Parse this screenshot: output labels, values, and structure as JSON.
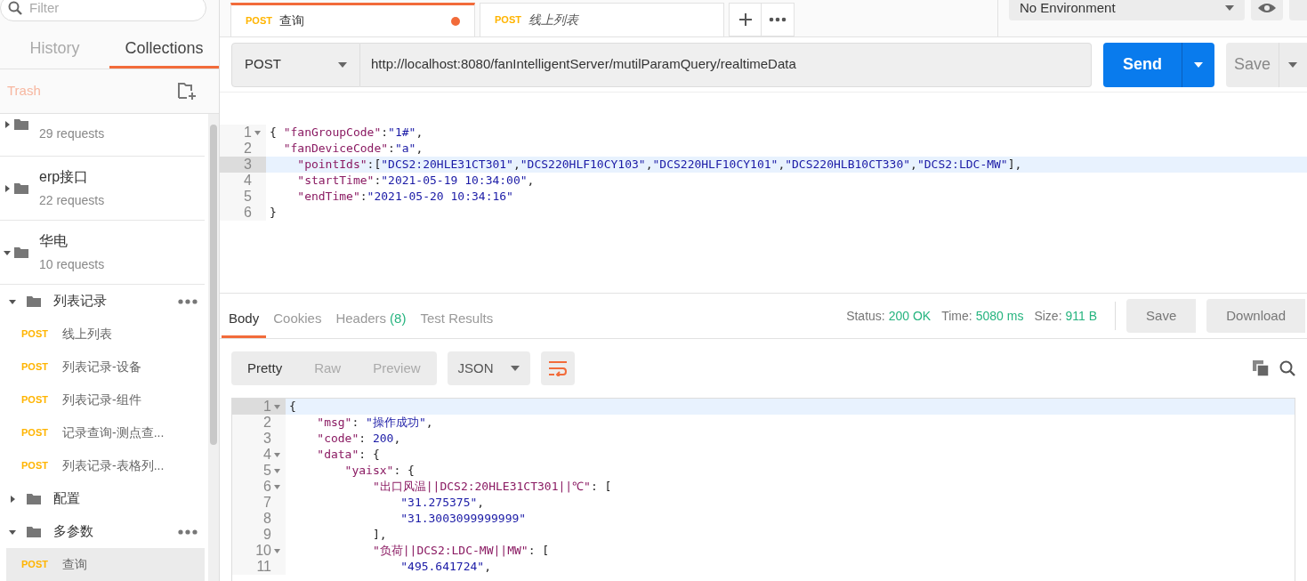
{
  "sidebar": {
    "search": {
      "placeholder": "Filter"
    },
    "tabs": [
      {
        "label": "History",
        "selected": false
      },
      {
        "label": "Collections",
        "selected": true
      }
    ],
    "trash": "Trash",
    "collections": [
      {
        "kind": "summary",
        "count": "29 requests",
        "expanded": false
      },
      {
        "kind": "summary",
        "name": "erp接口",
        "count": "22 requests",
        "expanded": false
      },
      {
        "kind": "summary",
        "name": "华电",
        "count": "10 requests",
        "expanded": true
      },
      {
        "kind": "folder",
        "name": "列表记录",
        "expanded": true,
        "children": [
          {
            "method": "POST",
            "name": "线上列表",
            "selected": false
          },
          {
            "method": "POST",
            "name": "列表记录-设备",
            "selected": false
          },
          {
            "method": "POST",
            "name": "列表记录-组件",
            "selected": false
          },
          {
            "method": "POST",
            "name": "记录查询-测点查...",
            "selected": false
          },
          {
            "method": "POST",
            "name": "列表记录-表格列...",
            "selected": false
          }
        ]
      },
      {
        "kind": "folder",
        "name": "配置",
        "expanded": false
      },
      {
        "kind": "folder",
        "name": "多参数",
        "expanded": true,
        "children": [
          {
            "method": "POST",
            "name": "查询",
            "selected": true
          }
        ]
      }
    ]
  },
  "tabs": [
    {
      "method": "POST",
      "label": "查询",
      "selected": true,
      "modified": true,
      "preview": false
    },
    {
      "method": "POST",
      "label": "线上列表",
      "selected": false,
      "modified": false,
      "preview": true
    }
  ],
  "environment": "No Environment",
  "request": {
    "method": "POST",
    "url": "http://localhost:8080/fanIntelligentServer/mutilParamQuery/realtimeData",
    "send": "Send",
    "save": "Save"
  },
  "request_body": [
    {
      "number": "1",
      "foldable": true,
      "highlighted": false,
      "tokens": [
        {
          "kind": "punct",
          "text": "{ "
        },
        {
          "kind": "key",
          "text": "\"fanGroupCode\""
        },
        {
          "kind": "punct",
          "text": ":"
        },
        {
          "kind": "string",
          "text": "\"1#\""
        },
        {
          "kind": "punct",
          "text": ","
        }
      ]
    },
    {
      "number": "2",
      "foldable": false,
      "highlighted": false,
      "tokens": [
        {
          "kind": "key",
          "text": "  \"fanDeviceCode\""
        },
        {
          "kind": "punct",
          "text": ":"
        },
        {
          "kind": "string",
          "text": "\"a\""
        },
        {
          "kind": "punct",
          "text": ","
        }
      ]
    },
    {
      "number": "3",
      "foldable": false,
      "highlighted": true,
      "tokens": [
        {
          "kind": "key",
          "text": "    \"pointIds\""
        },
        {
          "kind": "punct",
          "text": ":["
        },
        {
          "kind": "string",
          "text": "\"DCS2:20HLE31CT301\""
        },
        {
          "kind": "punct",
          "text": ","
        },
        {
          "kind": "string",
          "text": "\"DCS220HLF10CY103\""
        },
        {
          "kind": "punct",
          "text": ","
        },
        {
          "kind": "string",
          "text": "\"DCS220HLF10CY101\""
        },
        {
          "kind": "punct",
          "text": ","
        },
        {
          "kind": "string",
          "text": "\"DCS220HLB10CT330\""
        },
        {
          "kind": "punct",
          "text": ","
        },
        {
          "kind": "string",
          "text": "\"DCS2:LDC-MW\""
        },
        {
          "kind": "punct",
          "text": "],"
        }
      ]
    },
    {
      "number": "4",
      "foldable": false,
      "highlighted": false,
      "tokens": [
        {
          "kind": "key",
          "text": "    \"startTime\""
        },
        {
          "kind": "punct",
          "text": ":"
        },
        {
          "kind": "string",
          "text": "\"2021-05-19 10:34:00\""
        },
        {
          "kind": "punct",
          "text": ","
        }
      ]
    },
    {
      "number": "5",
      "foldable": false,
      "highlighted": false,
      "tokens": [
        {
          "kind": "key",
          "text": "    \"endTime\""
        },
        {
          "kind": "punct",
          "text": ":"
        },
        {
          "kind": "string",
          "text": "\"2021-05-20 10:34:16\""
        }
      ]
    },
    {
      "number": "6",
      "foldable": false,
      "highlighted": false,
      "tokens": [
        {
          "kind": "punct",
          "text": "}"
        }
      ]
    }
  ],
  "response": {
    "tabs": [
      {
        "label": "Body",
        "selected": true
      },
      {
        "label": "Cookies",
        "selected": false
      },
      {
        "label": "Headers",
        "count": "(8)",
        "selected": false
      },
      {
        "label": "Test Results",
        "selected": false
      }
    ],
    "stats": [
      {
        "label": "Status:",
        "value": "200 OK"
      },
      {
        "label": "Time:",
        "value": "5080 ms"
      },
      {
        "label": "Size:",
        "value": "911 B"
      }
    ],
    "buttons": [
      "Save",
      "Download"
    ],
    "views": [
      {
        "label": "Pretty",
        "selected": true
      },
      {
        "label": "Raw",
        "selected": false
      },
      {
        "label": "Preview",
        "selected": false
      }
    ],
    "format": "JSON",
    "body": [
      {
        "number": "1",
        "foldable": true,
        "highlighted": true,
        "tokens": [
          {
            "kind": "punct",
            "text": "{"
          }
        ]
      },
      {
        "number": "2",
        "foldable": false,
        "highlighted": false,
        "tokens": [
          {
            "kind": "key",
            "text": "    \"msg\""
          },
          {
            "kind": "punct",
            "text": ": "
          },
          {
            "kind": "string",
            "text": "\"操作成功\""
          },
          {
            "kind": "punct",
            "text": ","
          }
        ]
      },
      {
        "number": "3",
        "foldable": false,
        "highlighted": false,
        "tokens": [
          {
            "kind": "key",
            "text": "    \"code\""
          },
          {
            "kind": "punct",
            "text": ": "
          },
          {
            "kind": "number",
            "text": "200"
          },
          {
            "kind": "punct",
            "text": ","
          }
        ]
      },
      {
        "number": "4",
        "foldable": true,
        "highlighted": false,
        "tokens": [
          {
            "kind": "key",
            "text": "    \"data\""
          },
          {
            "kind": "punct",
            "text": ": {"
          }
        ]
      },
      {
        "number": "5",
        "foldable": true,
        "highlighted": false,
        "tokens": [
          {
            "kind": "key",
            "text": "        \"yaisx\""
          },
          {
            "kind": "punct",
            "text": ": {"
          }
        ]
      },
      {
        "number": "6",
        "foldable": true,
        "highlighted": false,
        "tokens": [
          {
            "kind": "key",
            "text": "            \"出口风温||DCS2:20HLE31CT301||℃\""
          },
          {
            "kind": "punct",
            "text": ": ["
          }
        ]
      },
      {
        "number": "7",
        "foldable": false,
        "highlighted": false,
        "tokens": [
          {
            "kind": "string",
            "text": "                \"31.275375\""
          },
          {
            "kind": "punct",
            "text": ","
          }
        ]
      },
      {
        "number": "8",
        "foldable": false,
        "highlighted": false,
        "tokens": [
          {
            "kind": "string",
            "text": "                \"31.3003099999999\""
          }
        ]
      },
      {
        "number": "9",
        "foldable": false,
        "highlighted": false,
        "tokens": [
          {
            "kind": "punct",
            "text": "            ],"
          }
        ]
      },
      {
        "number": "10",
        "foldable": true,
        "highlighted": false,
        "tokens": [
          {
            "kind": "key",
            "text": "            \"负荷||DCS2:LDC-MW||MW\""
          },
          {
            "kind": "punct",
            "text": ": ["
          }
        ]
      },
      {
        "number": "11",
        "foldable": false,
        "highlighted": false,
        "tokens": [
          {
            "kind": "string",
            "text": "                \"495.641724\""
          },
          {
            "kind": "punct",
            "text": ","
          }
        ]
      }
    ]
  }
}
